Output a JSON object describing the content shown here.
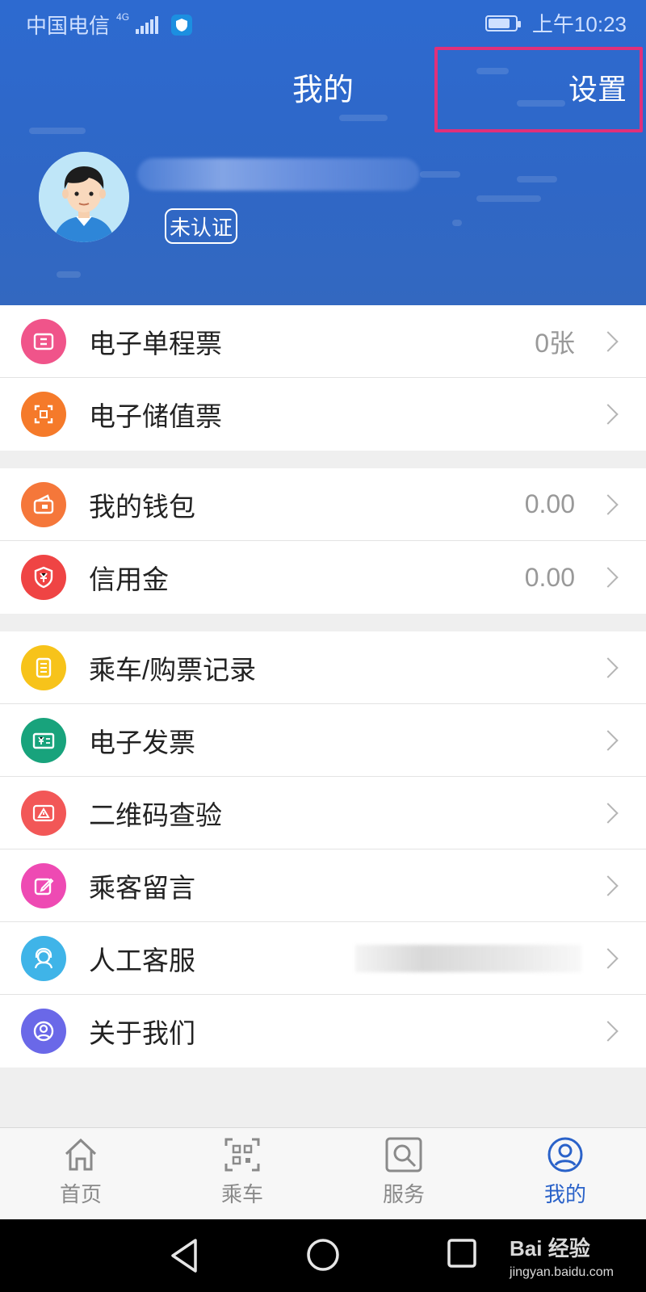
{
  "status_bar": {
    "carrier": "中国电信",
    "network": "4G",
    "time": "上午10:23"
  },
  "header": {
    "title": "我的",
    "settings_label": "设置",
    "verify_badge": "未认证"
  },
  "menu_groups": [
    {
      "items": [
        {
          "label": "电子单程票",
          "value": "0张",
          "icon": "ticket-icon",
          "color": "#f0548a"
        },
        {
          "label": "电子储值票",
          "value": "",
          "icon": "qr-card-icon",
          "color": "#f57a2a"
        }
      ]
    },
    {
      "items": [
        {
          "label": "我的钱包",
          "value": "0.00",
          "icon": "wallet-icon",
          "color": "#f5773a"
        },
        {
          "label": "信用金",
          "value": "0.00",
          "icon": "yuan-shield-icon",
          "color": "#ef4444"
        }
      ]
    },
    {
      "items": [
        {
          "label": "乘车/购票记录",
          "value": "",
          "icon": "records-icon",
          "color": "#f7c31a"
        },
        {
          "label": "电子发票",
          "value": "",
          "icon": "invoice-icon",
          "color": "#18a37c"
        },
        {
          "label": "二维码查验",
          "value": "",
          "icon": "warning-icon",
          "color": "#f25757"
        },
        {
          "label": "乘客留言",
          "value": "",
          "icon": "edit-icon",
          "color": "#ee4ab3"
        },
        {
          "label": "人工客服",
          "value": "",
          "icon": "headset-icon",
          "color": "#3fb4e8"
        },
        {
          "label": "关于我们",
          "value": "",
          "icon": "person-circle-icon",
          "color": "#6a68e8"
        }
      ]
    }
  ],
  "tabbar": {
    "tabs": [
      {
        "label": "首页",
        "icon": "home-icon"
      },
      {
        "label": "乘车",
        "icon": "qr-scan-icon"
      },
      {
        "label": "服务",
        "icon": "search-icon"
      },
      {
        "label": "我的",
        "icon": "profile-icon"
      }
    ],
    "active_color": "#2a62c9"
  },
  "watermark": {
    "brand": "Bai 经验",
    "url": "jingyan.baidu.com"
  }
}
